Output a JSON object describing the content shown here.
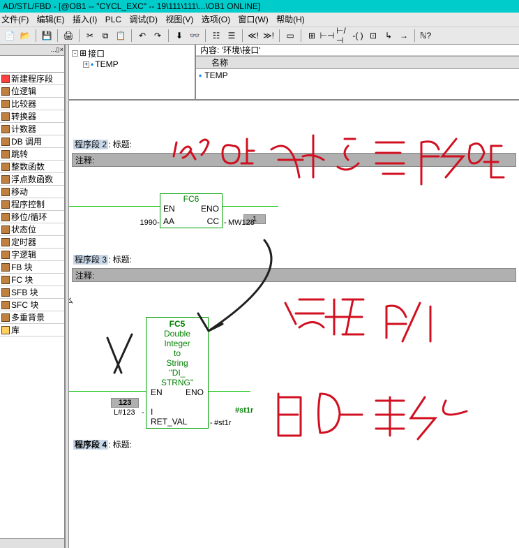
{
  "title": "AD/STL/FBD  - [@OB1 -- \"CYCL_EXC\" -- 19\\111\\111\\...\\OB1  ONLINE]",
  "menu": {
    "file": "文件(F)",
    "edit": "编辑(E)",
    "insert": "插入(I)",
    "plc": "PLC",
    "debug": "调试(D)",
    "view": "视图(V)",
    "options": "选项(O)",
    "window": "窗口(W)",
    "help": "帮助(H)"
  },
  "categories": [
    "新建程序段",
    "位逻辑",
    "比较器",
    "转换器",
    "计数器",
    "DB 调用",
    "跳转",
    "整数函数",
    "浮点数函数",
    "移动",
    "程序控制",
    "移位/循环",
    "状态位",
    "定时器",
    "字逻辑",
    "FB 块",
    "FC 块",
    "SFB 块",
    "SFC 块",
    "多重背景",
    "库"
  ],
  "content_hdr": "内容:  '环境\\接口'",
  "name_col": "名称",
  "iface_root": "接口",
  "iface_temp": "TEMP",
  "prop_temp": "TEMP",
  "seg2": {
    "title": "程序段 2",
    "colon_title": ": 标题:",
    "comment_lbl": "注释:"
  },
  "fc6": {
    "name": "FC6",
    "en": "EN",
    "eno": "ENO",
    "aa": "AA",
    "cc": "CC",
    "in_val": "1990",
    "out_mw": "MW128",
    "out_num": "1"
  },
  "seg3": {
    "title": "程序段 3",
    "colon_title": ": 标题:",
    "comment_lbl": "注释:"
  },
  "fc5": {
    "name": "FC5",
    "desc1": "Double",
    "desc2": "Integer",
    "desc3": "to",
    "desc4": "String",
    "strng1": "\"DI_",
    "strng2": "STRNG\"",
    "en": "EN",
    "eno": "ENO",
    "in_val_raw": "123",
    "in_val": "L#123",
    "in_pin": "I",
    "retval": "RET_VAL",
    "out": "#st1r",
    "out2": "#st1r"
  },
  "seg4": {
    "title": "程序段 4",
    "colon_title": ": 标题:"
  }
}
